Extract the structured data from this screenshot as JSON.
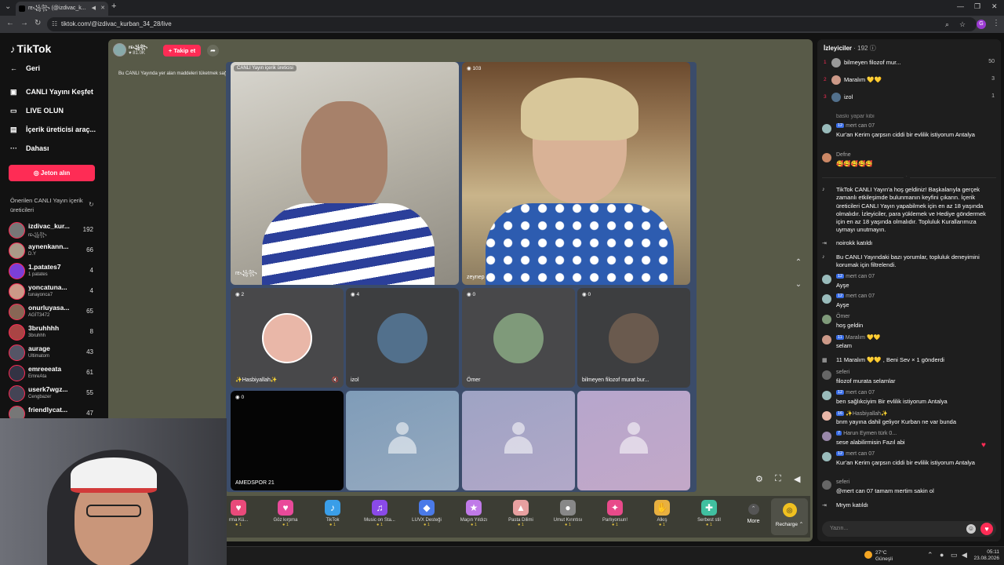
{
  "browser": {
    "tab_title": "rᴇ꧁꧂ (@izdivac_k...",
    "url": "tiktok.com/@izdivac_kurban_34_28/live",
    "profile_initial": "G"
  },
  "sidebar": {
    "logo": "TikTok",
    "back": "Geri",
    "items": [
      "CANLI Yayını Keşfet",
      "LIVE OLUN",
      "İçerik üreticisi araç...",
      "Dahası"
    ],
    "jeton_button": "Jeton alın",
    "suggested_title": "Önerilen CANLI Yayın içerik üreticileri",
    "creators": [
      {
        "name": "izdivac_kur...",
        "sub": "rᴇ꧁꧂",
        "count": "192"
      },
      {
        "name": "aynenkann...",
        "sub": "D.Y",
        "count": "66"
      },
      {
        "name": "1.patates7",
        "sub": "1 patates",
        "count": "4"
      },
      {
        "name": "yoncatuna...",
        "sub": "tunayonca7",
        "count": "4"
      },
      {
        "name": "onurluyasa...",
        "sub": "AGİT3472",
        "count": "65"
      },
      {
        "name": "3bruhhhh",
        "sub": "3bruhhh",
        "count": "8"
      },
      {
        "name": "aurage",
        "sub": "Ultimatom",
        "count": "43"
      },
      {
        "name": "emreeeata",
        "sub": "EmreAta",
        "count": "61"
      },
      {
        "name": "userk7wgz...",
        "sub": "Cengbazer",
        "count": "55"
      },
      {
        "name": "friendlycat...",
        "sub": "",
        "count": "47"
      }
    ]
  },
  "stream": {
    "host_name": "rᴇ꧁꧂",
    "host_likes": "81.0K",
    "follow_button": "+ Takip et",
    "notice": "Bu CANLI Yayında yer alan maddeleri tüketmek sağlığ",
    "host_caption": "CANLI Yayın içerik üreticisi",
    "cells": [
      {
        "label": "rᴇ꧁꧂",
        "badge": ""
      },
      {
        "label": "zeynep",
        "badge": "103"
      },
      {
        "label": "✨Hasbiyallah✨",
        "badge": "2"
      },
      {
        "label": "izol",
        "badge": "4"
      },
      {
        "label": "Ömer",
        "badge": "0"
      },
      {
        "label": "bilmeyen filozof murat bur...",
        "badge": "0"
      },
      {
        "label": "AMEDSPOR 21",
        "badge": "0"
      }
    ]
  },
  "gifts": [
    {
      "name": "rma Kü...",
      "price": "1",
      "color": "#e94a7a",
      "icon": "heart-gift-icon"
    },
    {
      "name": "Göz kırpma",
      "price": "1",
      "color": "#e94a9a",
      "icon": "wink-icon"
    },
    {
      "name": "TikTok",
      "price": "1",
      "color": "#3a9ee8",
      "icon": "tiktok-gift-icon"
    },
    {
      "name": "Music on Sta...",
      "price": "1",
      "color": "#8a4ae8",
      "icon": "music-icon"
    },
    {
      "name": "LUVX Desteği",
      "price": "1",
      "color": "#4a7ae8",
      "icon": "luvx-icon"
    },
    {
      "name": "Maçın Yıldızı",
      "price": "1",
      "color": "#c07ae8",
      "icon": "star-icon"
    },
    {
      "name": "Pasta Dilimi",
      "price": "1",
      "color": "#e8a0a0",
      "icon": "cake-icon"
    },
    {
      "name": "Umut Kırıntısı",
      "price": "1",
      "color": "#888888",
      "icon": "stone-icon"
    },
    {
      "name": "Parlıyorsun!",
      "price": "1",
      "color": "#e84a8a",
      "icon": "shine-icon"
    },
    {
      "name": "Alkış",
      "price": "1",
      "color": "#e8b040",
      "icon": "clap-icon"
    },
    {
      "name": "Serbest stil",
      "price": "1",
      "color": "#40c0a0",
      "icon": "freestyle-icon"
    }
  ],
  "more_label": "More",
  "recharge_label": "Recharge",
  "chat": {
    "title": "İzleyiciler",
    "viewer_count": "· 192",
    "ranking": [
      {
        "rank": "1",
        "name": "bilmeyen filozof mur...",
        "count": "50"
      },
      {
        "rank": "2",
        "name": "Maralım 💛💛",
        "count": "3"
      },
      {
        "rank": "3",
        "name": "izol",
        "count": "1"
      }
    ],
    "partial_top": "baskı yapar kibi",
    "messages": [
      {
        "type": "msg",
        "level": "12",
        "user": "mert can 07",
        "text": "Kur'an Kerim çarpsın ciddi bir evlilik istiyorum Antalya"
      },
      {
        "type": "msg",
        "level": "",
        "user": "Defne",
        "text": "🥰🥰🥰🥰🥰"
      },
      {
        "type": "sys",
        "icon": "tiktok-icon",
        "text": "TikTok CANLI Yayın'a hoş geldiniz! Başkalarıyla gerçek zamanlı etkileşimde bulunmanın keyfini çıkarın. İçerik üreticileri CANLI Yayın yapabilmek için en az 18 yaşında olmalıdır. İzleyiciler, para yüklemek ve Hediye göndermek için en az 18 yaşında olmalıdır. Topluluk Kurallarımıza uymayı unutmayın."
      },
      {
        "type": "sys",
        "icon": "join-icon",
        "text": "noirokk katıldı"
      },
      {
        "type": "sys",
        "icon": "tiktok-icon",
        "text": "Bu CANLI Yayındaki bazı yorumlar, topluluk deneyimini korumak için filtrelendi."
      },
      {
        "type": "msg",
        "level": "12",
        "user": "mert can 07",
        "text": "Ayşe"
      },
      {
        "type": "msg",
        "level": "12",
        "user": "mert can 07",
        "text": "Ayşe"
      },
      {
        "type": "msg",
        "level": "",
        "user": "Ömer",
        "text": "hoş geldin"
      },
      {
        "type": "msg",
        "level": "11",
        "user": "Maralım 💛💛",
        "text": "selam"
      },
      {
        "type": "sys",
        "icon": "gift-icon",
        "text": "11 Maralım 💛💛 , Beni Sev × 1 gönderdi"
      },
      {
        "type": "msg",
        "level": "",
        "user": "seferi",
        "text": "filozof murata selamlar"
      },
      {
        "type": "msg",
        "level": "12",
        "user": "mert can 07",
        "text": "ben sağlıkciyim Bir evlilik istiyorum Antalya"
      },
      {
        "type": "msg",
        "level": "16",
        "user": "✨Hasbiyallah✨",
        "text": "bnm yayına dahil geliyor Kurban ne var bunda"
      },
      {
        "type": "msg",
        "level": "7",
        "user": "Harun Eymen türk 0...",
        "text": "sese alabilirmisin Fazıl abi"
      },
      {
        "type": "msg",
        "level": "12",
        "user": "mert can 07",
        "text": "Kur'an Kerim çarpsın ciddi bir evlilik istiyorum Antalya"
      },
      {
        "type": "msg",
        "level": "",
        "user": "seferi",
        "text": "@mert can 07 tamam mertim sakin ol"
      },
      {
        "type": "sys",
        "icon": "join-icon",
        "text": "Mrym katıldı"
      }
    ],
    "input_placeholder": "Yazın..."
  },
  "taskbar": {
    "temp": "27°C",
    "weather": "Güneşli",
    "time": "05:11",
    "date": "23.08.2026"
  }
}
